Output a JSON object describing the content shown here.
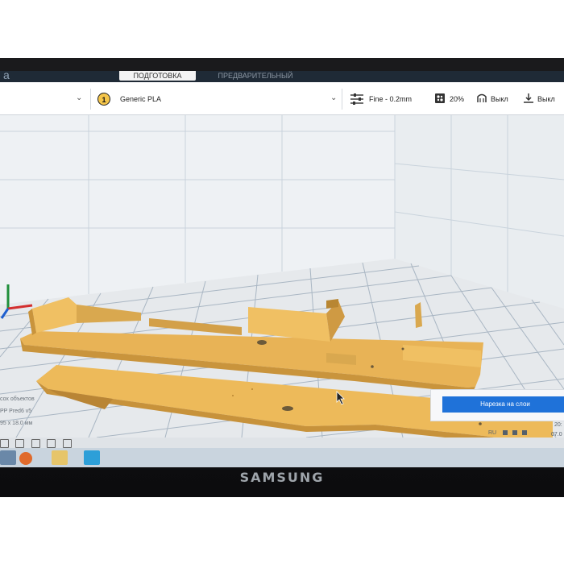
{
  "app": {
    "logo_glyph": "a",
    "stage_tabs": [
      {
        "label": "ПОДГОТОВКА",
        "active": true
      },
      {
        "label": "ПРЕДВАРИТЕЛЬНЫЙ ПРОСМОТР",
        "active": false
      }
    ]
  },
  "toolbar": {
    "extruder_number": "1",
    "material": "Generic PLA",
    "profile": "Fine - 0.2mm",
    "infill": "20%",
    "support": "Выкл",
    "adhesion": "Выкл",
    "icons": [
      "chevron-down-icon",
      "profile-sliders-icon",
      "infill-icon",
      "support-icon",
      "adhesion-icon"
    ]
  },
  "object_info": {
    "objects_line": "сох объектов",
    "printer_line": "PP Pred6 v5",
    "dims_line": "95 x 18.0 мм"
  },
  "slice": {
    "button_label": "Нарезка на слои"
  },
  "tray": {
    "lang": "RU",
    "time": "20:",
    "date": "07.0"
  },
  "monitor_brand": "SAMSUNG",
  "colors": {
    "model": "#e8b356",
    "accent": "#1f72d9",
    "buildplate": "#e6e9ec",
    "grid": "#a9b6c3"
  }
}
